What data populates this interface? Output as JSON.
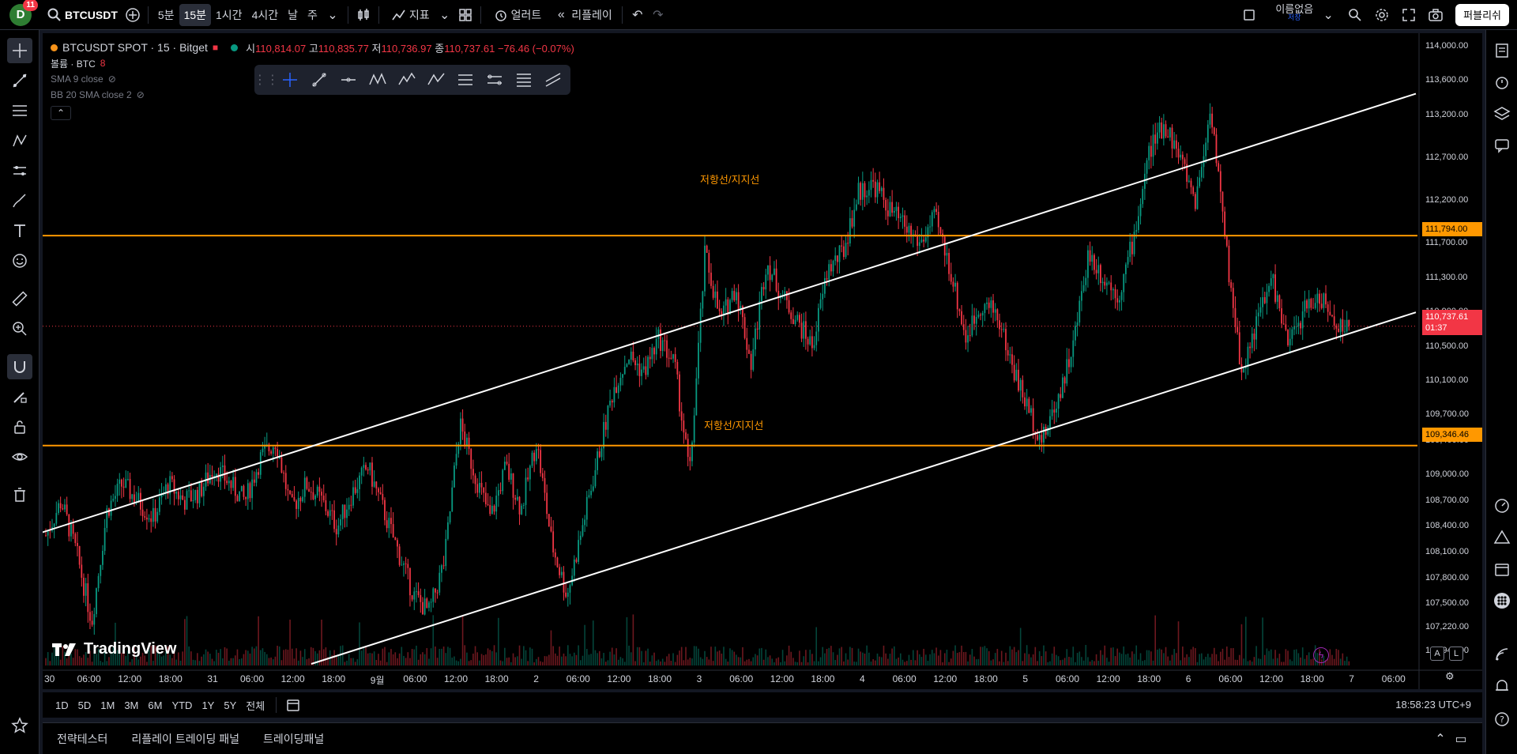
{
  "topbar": {
    "avatar_letter": "D",
    "avatar_badge": "11",
    "symbol": "BTCUSDT",
    "intervals": [
      "5분",
      "15분",
      "1시간",
      "4시간",
      "날",
      "주"
    ],
    "active_interval": "15분",
    "indicators_label": "지표",
    "alert_label": "얼러트",
    "replay_label": "리플레이",
    "layout_name": "이름없음",
    "layout_saved": "저장",
    "publish_label": "퍼블리쉬"
  },
  "legend": {
    "title": "BTCUSDT SPOT · 15 · Bitget",
    "open_label": "시",
    "open": "110,814.07",
    "high_label": "고",
    "high": "110,835.77",
    "low_label": "저",
    "low": "110,736.97",
    "close_label": "종",
    "close": "110,737.61",
    "change": "−76.46 (−0.07%)",
    "volume_label": "볼륨 · BTC",
    "volume_value": "8",
    "sma_label": "SMA 9 close",
    "bb_label": "BB 20 SMA close 2"
  },
  "annotations": {
    "upper_line_text": "저항선/지지선",
    "lower_line_text": "저항선/지지선"
  },
  "watermark": "TradingView",
  "price_axis": [
    "114,000.00",
    "113,600.00",
    "113,200.00",
    "112,700.00",
    "112,200.00",
    "111,700.00",
    "111,300.00",
    "110,900.00",
    "110,500.00",
    "110,100.00",
    "109,700.00",
    "109,400.00",
    "109,000.00",
    "108,700.00",
    "108,400.00",
    "108,100.00",
    "107,800.00",
    "107,500.00",
    "107,220.00",
    "106,945.00"
  ],
  "price_tags": {
    "upper_level": "111,794.00",
    "current_price": "110,737.61",
    "countdown": "01:37",
    "lower_level": "109,346.46"
  },
  "time_axis": [
    "30",
    "06:00",
    "12:00",
    "18:00",
    "31",
    "06:00",
    "12:00",
    "18:00",
    "9월",
    "06:00",
    "12:00",
    "18:00",
    "2",
    "06:00",
    "12:00",
    "18:00",
    "3",
    "06:00",
    "12:00",
    "18:00",
    "4",
    "06:00",
    "12:00",
    "18:00",
    "5",
    "06:00",
    "12:00",
    "18:00",
    "6",
    "06:00",
    "12:00",
    "18:00",
    "7",
    "06:00"
  ],
  "axis_buttons": {
    "auto": "A",
    "log": "L"
  },
  "range_buttons": [
    "1D",
    "5D",
    "1M",
    "3M",
    "6M",
    "YTD",
    "1Y",
    "5Y",
    "전체"
  ],
  "clock": "18:58:23 UTC+9",
  "bottom_tabs": [
    "전략테스터",
    "리플레이 트레이딩 패널",
    "트레이딩패널"
  ],
  "colors": {
    "up": "#089981",
    "down": "#f23645",
    "level_line": "#ff9800",
    "channel": "#ffffff",
    "background": "#000000"
  },
  "chart_data": {
    "type": "candlestick",
    "symbol": "BTCUSDT",
    "interval": "15",
    "exchange": "Bitget",
    "ylim": [
      106945,
      114000
    ],
    "horizontal_levels": [
      111794.0,
      109346.46
    ],
    "last_price": 110737.61,
    "price_path": [
      108300,
      108700,
      108100,
      107300,
      108600,
      108900,
      108700,
      108500,
      108900,
      108700,
      108800,
      109100,
      108900,
      108700,
      109200,
      109400,
      108600,
      108900,
      108700,
      108400,
      108800,
      109100,
      108600,
      108100,
      107600,
      107400,
      108000,
      109600,
      109000,
      108500,
      109100,
      108600,
      109400,
      108200,
      107600,
      108400,
      109200,
      110000,
      110400,
      110200,
      110600,
      110300,
      109000,
      111600,
      110800,
      111200,
      110300,
      111500,
      111100,
      110800,
      110500,
      111400,
      111600,
      112300,
      112400,
      112100,
      111900,
      111700,
      112000,
      111400,
      110600,
      111000,
      110900,
      110300,
      109800,
      109400,
      109900,
      110500,
      111600,
      111300,
      111100,
      111800,
      112800,
      113100,
      112700,
      112200,
      113300,
      111600,
      110200,
      110800,
      111300,
      110500,
      110900,
      111100,
      110800,
      110700
    ]
  }
}
